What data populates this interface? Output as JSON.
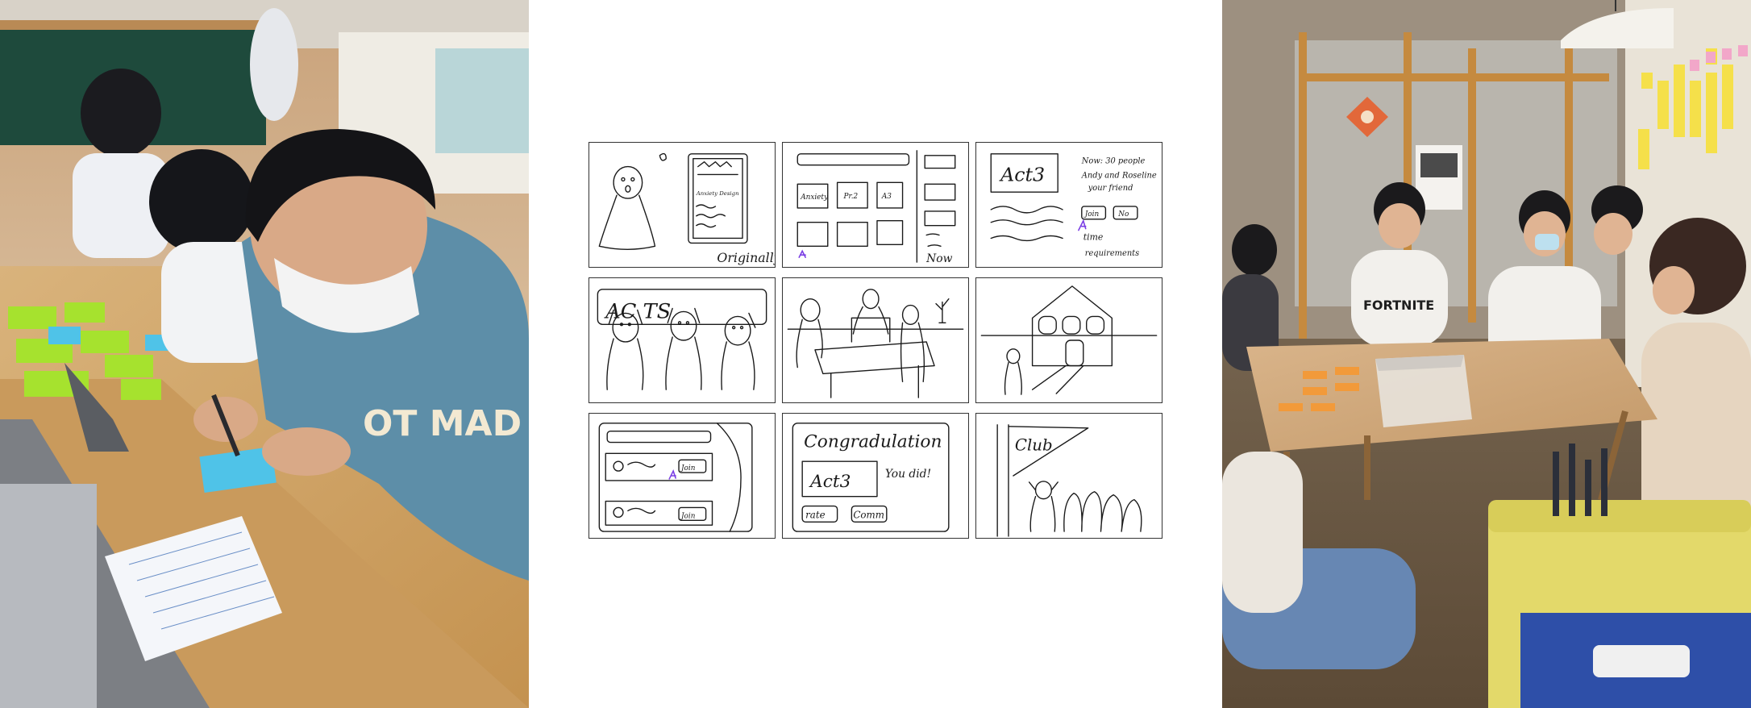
{
  "left_photo": {
    "icon": "classroom-photo"
  },
  "right_photo": {
    "icon": "workshop-photo"
  },
  "storyboard": {
    "panel1": {
      "caption": "Originally",
      "note": "Anxiety Design"
    },
    "panel2": {
      "caption": "Now",
      "boxes": [
        "Anxiety",
        "Pr.2",
        "A3"
      ]
    },
    "panel3": {
      "title": "Act3",
      "note_line1": "Now: 30 people",
      "note_line2": "Andy and Roseline",
      "note_line3": "your friend",
      "yes": "Join",
      "no": "No",
      "time": "time",
      "req": "requirements"
    },
    "panel4": {
      "label": "AC    TS"
    },
    "panel5": {},
    "panel6": {},
    "panel7": {
      "join": "Join",
      "join2": "Join"
    },
    "panel8": {
      "title": "Congradulation",
      "box": "Act3",
      "side": "You did!",
      "rate": "rate",
      "comm": "Comm"
    },
    "panel9": {
      "label": "Club"
    }
  }
}
